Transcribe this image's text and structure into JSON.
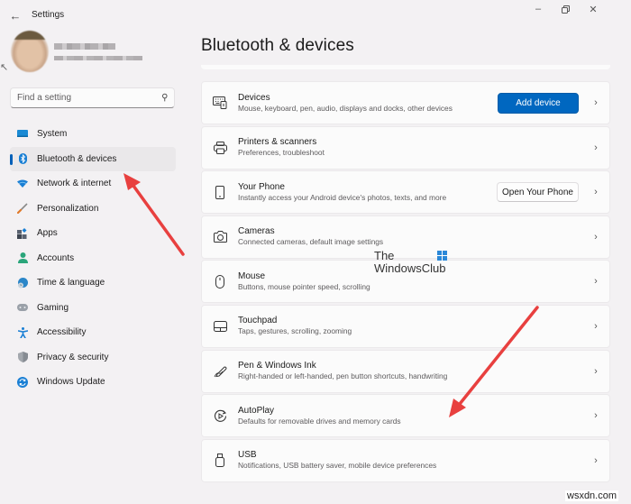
{
  "window": {
    "app_title": "Settings",
    "back_icon": "back-arrow-icon",
    "minimize_icon": "minimize-icon",
    "maximize_icon": "restore-icon",
    "close_icon": "close-icon"
  },
  "profile": {
    "name": "(blurred)",
    "email": "(blurred)"
  },
  "search": {
    "placeholder": "Find a setting",
    "value": ""
  },
  "sidebar": {
    "items": [
      {
        "label": "System",
        "icon": "system-icon",
        "active": false
      },
      {
        "label": "Bluetooth & devices",
        "icon": "bluetooth-icon",
        "active": true
      },
      {
        "label": "Network & internet",
        "icon": "wifi-icon",
        "active": false
      },
      {
        "label": "Personalization",
        "icon": "brush-icon",
        "active": false
      },
      {
        "label": "Apps",
        "icon": "apps-icon",
        "active": false
      },
      {
        "label": "Accounts",
        "icon": "person-icon",
        "active": false
      },
      {
        "label": "Time & language",
        "icon": "globe-clock-icon",
        "active": false
      },
      {
        "label": "Gaming",
        "icon": "gamepad-icon",
        "active": false
      },
      {
        "label": "Accessibility",
        "icon": "accessibility-icon",
        "active": false
      },
      {
        "label": "Privacy & security",
        "icon": "shield-icon",
        "active": false
      },
      {
        "label": "Windows Update",
        "icon": "update-icon",
        "active": false
      }
    ]
  },
  "main": {
    "title": "Bluetooth & devices",
    "cards": [
      {
        "title": "Devices",
        "subtitle": "Mouse, keyboard, pen, audio, displays and docks, other devices",
        "icon": "devices-icon",
        "button": "Add device"
      },
      {
        "title": "Printers & scanners",
        "subtitle": "Preferences, troubleshoot",
        "icon": "printer-icon"
      },
      {
        "title": "Your Phone",
        "subtitle": "Instantly access your Android device's photos, texts, and more",
        "icon": "phone-icon",
        "button": "Open Your Phone"
      },
      {
        "title": "Cameras",
        "subtitle": "Connected cameras, default image settings",
        "icon": "camera-icon"
      },
      {
        "title": "Mouse",
        "subtitle": "Buttons, mouse pointer speed, scrolling",
        "icon": "mouse-icon"
      },
      {
        "title": "Touchpad",
        "subtitle": "Taps, gestures, scrolling, zooming",
        "icon": "touchpad-icon"
      },
      {
        "title": "Pen & Windows Ink",
        "subtitle": "Right-handed or left-handed, pen button shortcuts, handwriting",
        "icon": "pen-icon"
      },
      {
        "title": "AutoPlay",
        "subtitle": "Defaults for removable drives and memory cards",
        "icon": "autoplay-icon"
      },
      {
        "title": "USB",
        "subtitle": "Notifications, USB battery saver, mobile device preferences",
        "icon": "usb-icon"
      }
    ]
  },
  "watermarks": {
    "twc_line1": "The",
    "twc_line2": "WindowsClub",
    "site": "wsxdn.com"
  },
  "colors": {
    "accent": "#0067c0",
    "annotation_arrow": "#e8403f"
  }
}
